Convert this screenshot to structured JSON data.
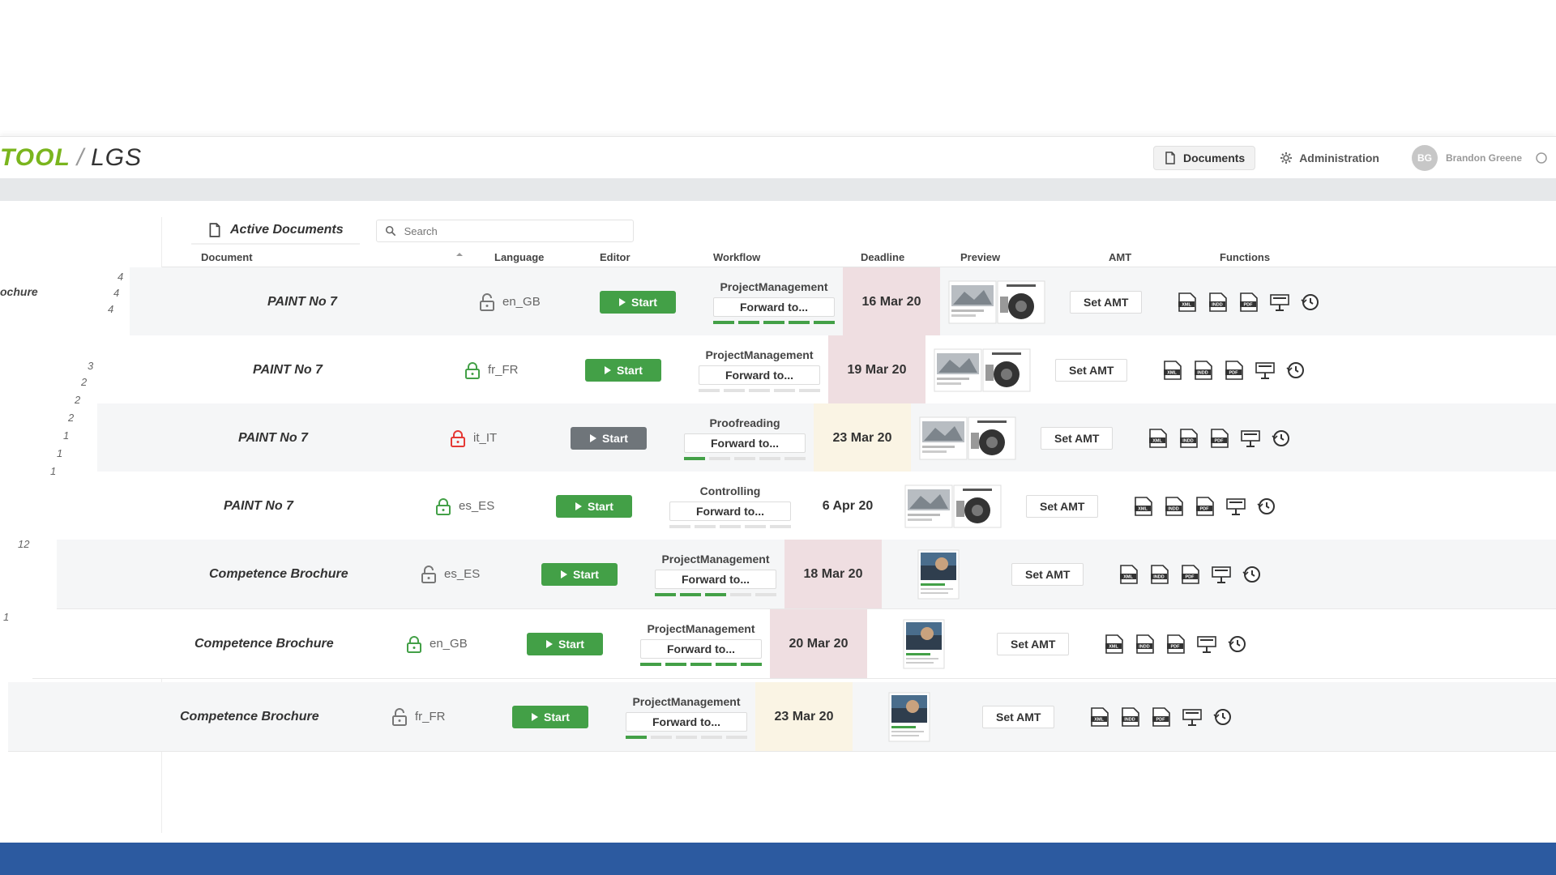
{
  "colors": {
    "brand_green": "#7ab51d",
    "start_green": "#43a047",
    "start_disabled": "#6f757a",
    "deadline_overdue": "#efdee1",
    "deadline_soon": "#faf4e4",
    "lock_green": "#43a047",
    "lock_red": "#e53935",
    "bottom_band": "#2c5aa0"
  },
  "header": {
    "logo_brand": "TOOL",
    "logo_separator": "/",
    "logo_product": "LGS",
    "nav": {
      "documents_label": "Documents",
      "documents_icon": "document-icon",
      "administration_label": "Administration",
      "administration_icon": "gear-icon"
    },
    "user": {
      "initials": "BG",
      "name": "Brandon Greene"
    }
  },
  "left_panel": {
    "label": "ochure",
    "counts": [
      "4",
      "4",
      "4",
      "3",
      "2",
      "2",
      "2",
      "1",
      "1",
      "1",
      "12",
      "1"
    ]
  },
  "toolbar": {
    "title": "Active Documents",
    "title_icon": "document-icon",
    "search_placeholder": "Search",
    "search_icon": "search-icon"
  },
  "columns": {
    "document": "Document",
    "language": "Language",
    "editor": "Editor",
    "workflow": "Workflow",
    "deadline": "Deadline",
    "preview": "Preview",
    "amt": "AMT",
    "functions": "Functions"
  },
  "rows": [
    {
      "document": "PAINT No 7",
      "lock": "open",
      "language": "en_GB",
      "editor": "Start",
      "editor_enabled": true,
      "workflow_stage": "ProjectManagement",
      "forward": "Forward to...",
      "progress": 5,
      "deadline": "16 Mar 20",
      "deadline_status": "overdue",
      "amt": "Set AMT"
    },
    {
      "document": "PAINT No 7",
      "lock": "green",
      "language": "fr_FR",
      "editor": "Start",
      "editor_enabled": true,
      "workflow_stage": "ProjectManagement",
      "forward": "Forward to...",
      "progress": 0,
      "deadline": "19 Mar 20",
      "deadline_status": "overdue",
      "amt": "Set AMT"
    },
    {
      "document": "PAINT No 7",
      "lock": "red",
      "language": "it_IT",
      "editor": "Start",
      "editor_enabled": false,
      "workflow_stage": "Proofreading",
      "forward": "Forward to...",
      "progress": 1,
      "deadline": "23 Mar 20",
      "deadline_status": "soon",
      "amt": "Set AMT"
    },
    {
      "document": "PAINT No 7",
      "lock": "green",
      "language": "es_ES",
      "editor": "Start",
      "editor_enabled": true,
      "workflow_stage": "Controlling",
      "forward": "Forward to...",
      "progress": 0,
      "deadline": "6 Apr 20",
      "deadline_status": "normal",
      "amt": "Set AMT"
    },
    {
      "document": "Competence Brochure",
      "lock": "open",
      "language": "es_ES",
      "editor": "Start",
      "editor_enabled": true,
      "workflow_stage": "ProjectManagement",
      "forward": "Forward to...",
      "progress": 3,
      "deadline": "18 Mar 20",
      "deadline_status": "overdue",
      "amt": "Set AMT"
    },
    {
      "document": "Competence Brochure",
      "lock": "green",
      "language": "en_GB",
      "editor": "Start",
      "editor_enabled": true,
      "workflow_stage": "ProjectManagement",
      "forward": "Forward to...",
      "progress": 5,
      "deadline": "20 Mar 20",
      "deadline_status": "overdue",
      "amt": "Set AMT"
    },
    {
      "document": "Competence Brochure",
      "lock": "open",
      "language": "fr_FR",
      "editor": "Start",
      "editor_enabled": true,
      "workflow_stage": "ProjectManagement",
      "forward": "Forward to...",
      "progress": 1,
      "deadline": "23 Mar 20",
      "deadline_status": "soon",
      "amt": "Set AMT"
    }
  ],
  "function_icons": [
    "xml-file-icon",
    "indd-file-icon",
    "pdf-file-icon",
    "presentation-icon",
    "history-icon"
  ]
}
